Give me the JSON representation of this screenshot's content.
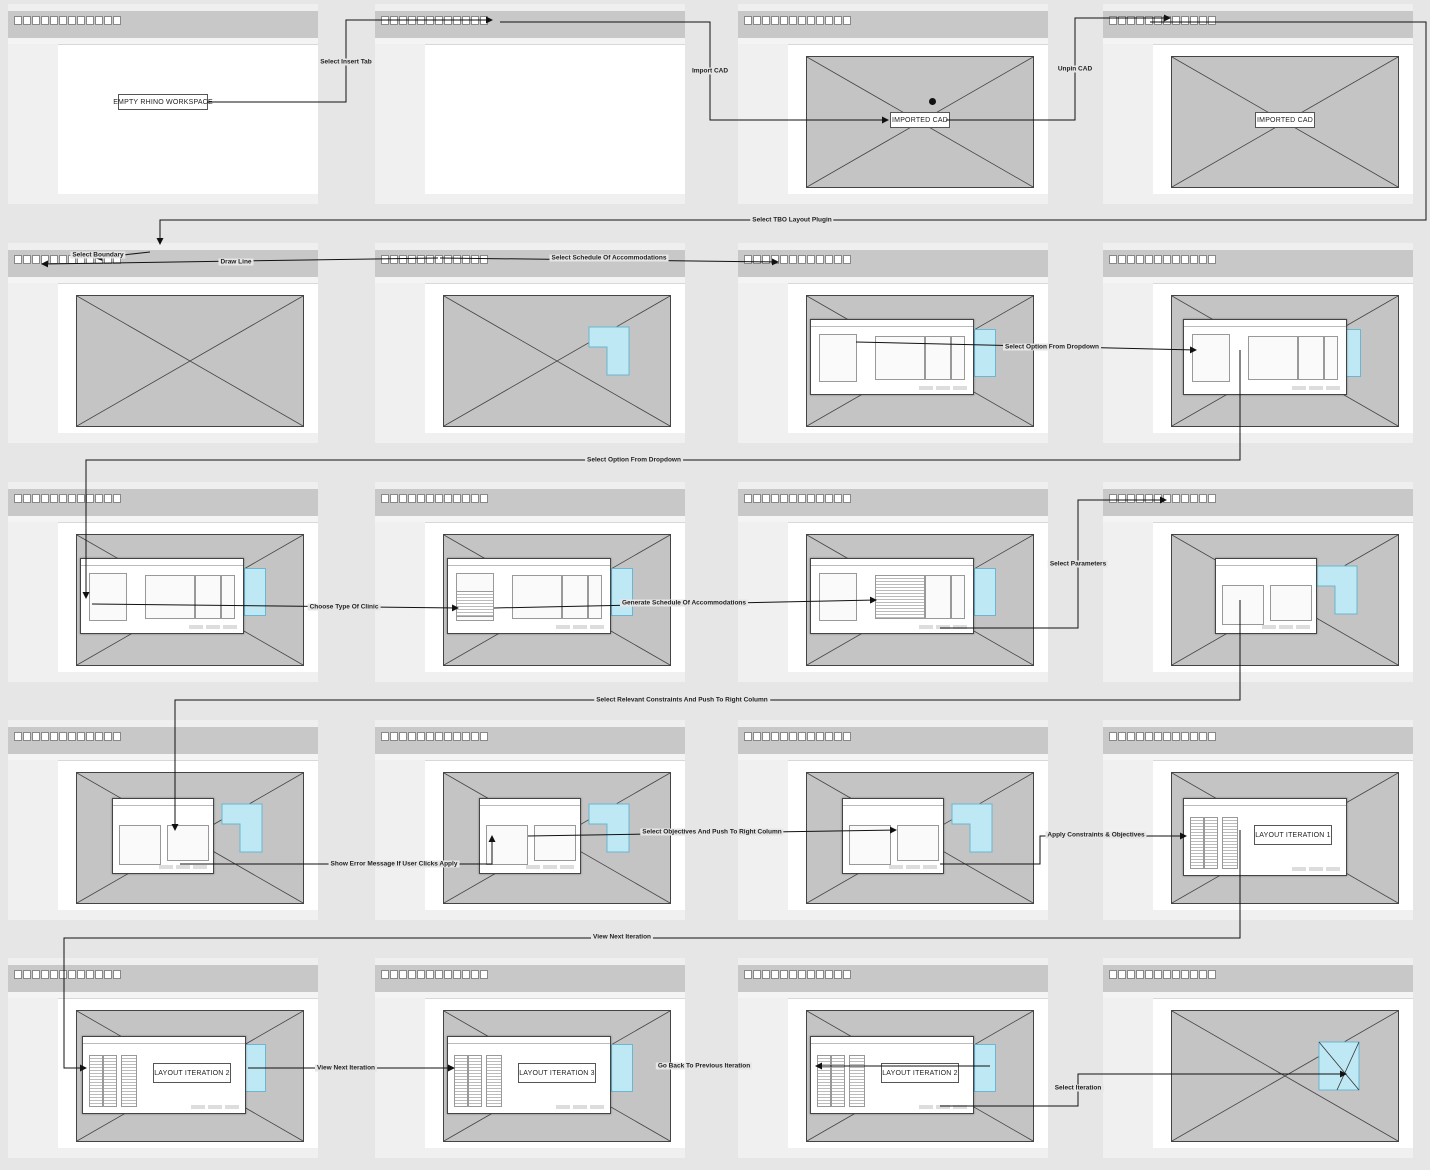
{
  "workspace_label": "EMPTY RHINO WORKSPACE",
  "imported_label": "IMPORTED CAD",
  "iteration_labels": [
    "LAYOUT ITERATION 1",
    "LAYOUT ITERATION 2",
    "LAYOUT ITERATION 3"
  ],
  "steps": {
    "select_insert_tab": "Select Insert Tab",
    "import_cad": "Import CAD",
    "unpin_cad": "Unpin CAD",
    "select_tbo_plugin": "Select TBO Layout Plugin",
    "select_boundary": "Select Boundary",
    "draw_line": "Draw Line",
    "select_schedule": "Select Schedule Of Accommodations",
    "select_option_1": "Select Option From Dropdown",
    "select_option_2": "Select Option From Dropdown",
    "choose_clinic": "Choose Type Of Clinic",
    "generate_schedule": "Generate Schedule Of Accommodations",
    "select_parameters": "Select Parameters",
    "select_constraints": "Select Relevant Constraints And Push To Right Column",
    "show_error": "Show Error Message If User Clicks Apply",
    "select_objectives": "Select Objectives And Push To Right Column",
    "apply": "Apply Constraints & Objectives",
    "view_next_1": "View Next Iteration",
    "view_next_2": "View Next Iteration",
    "go_back": "Go Back To Previous Iteration",
    "select_iteration": "Select Iteration"
  }
}
